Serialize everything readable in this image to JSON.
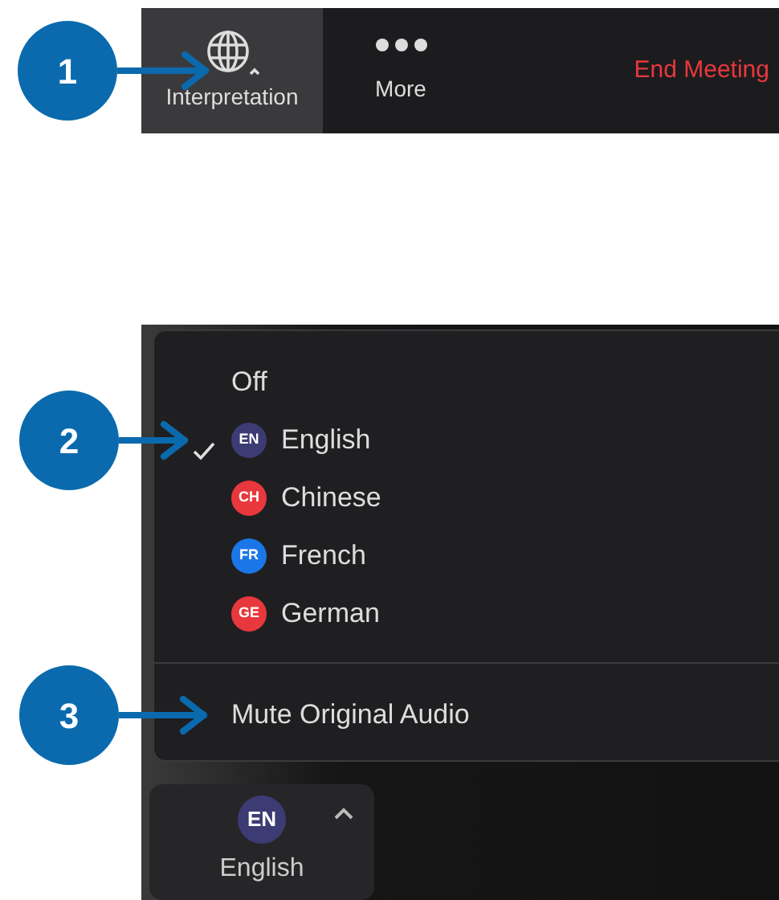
{
  "toolbar": {
    "buttons": [
      {
        "kind": "globe",
        "label": "Interpretation",
        "selected": true,
        "callout": "1"
      },
      {
        "kind": "dots",
        "label": "More",
        "selected": false
      }
    ],
    "end_button": "End Meeting"
  },
  "language_menu": {
    "items": [
      {
        "label": "Off",
        "checked": false
      },
      {
        "badge": "EN",
        "label": "English",
        "color": "#3d3b73",
        "checked": true,
        "callout": "2"
      },
      {
        "badge": "CH",
        "label": "Chinese",
        "color": "#e8383d",
        "checked": false
      },
      {
        "badge": "FR",
        "label": "French",
        "color": "#1b76e8",
        "checked": false
      },
      {
        "badge": "GE",
        "label": "German",
        "color": "#e8383d",
        "checked": false
      }
    ],
    "footer_item": {
      "label": "Mute Original Audio",
      "callout": "3"
    }
  },
  "language_button": {
    "badge": "EN",
    "label": "English",
    "color": "#3d3b73"
  }
}
